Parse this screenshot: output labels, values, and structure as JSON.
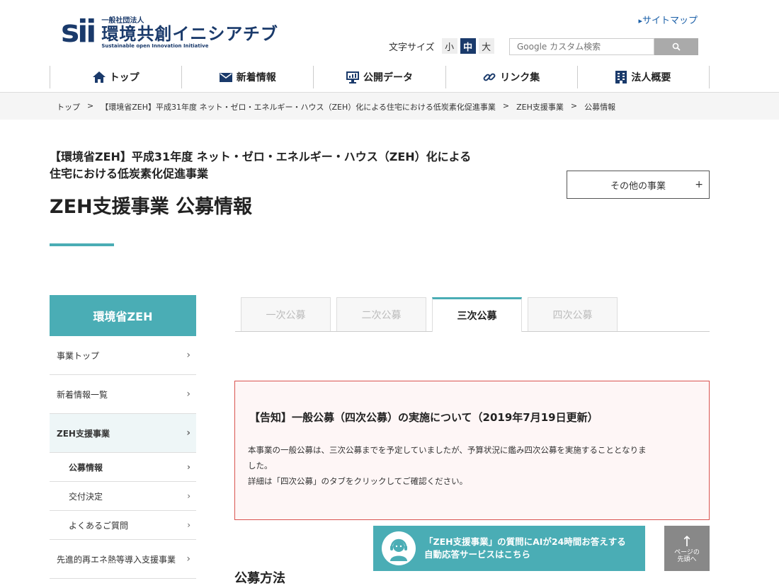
{
  "header": {
    "logo_mark": "sii",
    "logo_small": "一般社団法人",
    "logo_big": "環境共創イニシアチブ",
    "logo_en": "Sustainable open Innovation Initiative",
    "sitemap": "サイトマップ",
    "fontsize_label": "文字サイズ",
    "fontsize_small": "小",
    "fontsize_medium": "中",
    "fontsize_large": "大",
    "search_placeholder": "Google カスタム検索"
  },
  "gnav": [
    {
      "label": "トップ",
      "icon": "home-icon"
    },
    {
      "label": "新着情報",
      "icon": "mail-icon"
    },
    {
      "label": "公開データ",
      "icon": "monitor-icon"
    },
    {
      "label": "リンク集",
      "icon": "link-icon"
    },
    {
      "label": "法人概要",
      "icon": "building-icon"
    }
  ],
  "breadcrumb": [
    "トップ",
    "【環境省ZEH】平成31年度 ネット・ゼロ・エネルギー・ハウス（ZEH）化による住宅における低炭素化促進事業",
    "ZEH支援事業",
    "公募情報"
  ],
  "page": {
    "sub_title_line1": "【環境省ZEH】平成31年度 ネット・ゼロ・エネルギー・ハウス（ZEH）化による",
    "sub_title_line2": "住宅における低炭素化促進事業",
    "main_title": "ZEH支援事業 公募情報",
    "other_button": "その他の事業",
    "other_plus": "+"
  },
  "sidebar": {
    "heading": "環境省ZEH",
    "items": [
      {
        "label": "事業トップ"
      },
      {
        "label": "新着情報一覧"
      },
      {
        "label": "ZEH支援事業"
      },
      {
        "label": "公募情報"
      },
      {
        "label": "交付決定"
      },
      {
        "label": "よくあるご質問"
      },
      {
        "label": "先進的再エネ熱等導入支援事業"
      }
    ]
  },
  "tabs": [
    "一次公募",
    "二次公募",
    "三次公募",
    "四次公募"
  ],
  "notice": {
    "title": "【告知】一般公募（四次公募）の実施について（2019年7月19日更新）",
    "line1": "本事業の一般公募は、三次公募までを予定していましたが、予算状況に鑑み四次公募を実施することとなりま",
    "line2": "した。",
    "line3": "詳細は「四次公募」のタブをクリックしてご確認ください。"
  },
  "ai_banner": {
    "line1": "「ZEH支援事業」の質問にAIが24時間お答えする",
    "line2": "自動応答サービスはこちら"
  },
  "pagetop": {
    "line1": "ページの",
    "line2": "先頭へ"
  },
  "section_heading": "公募方法",
  "colors": {
    "accent": "#4aadb5",
    "navy": "#1a3a6b",
    "notice_border": "#d9534f"
  }
}
